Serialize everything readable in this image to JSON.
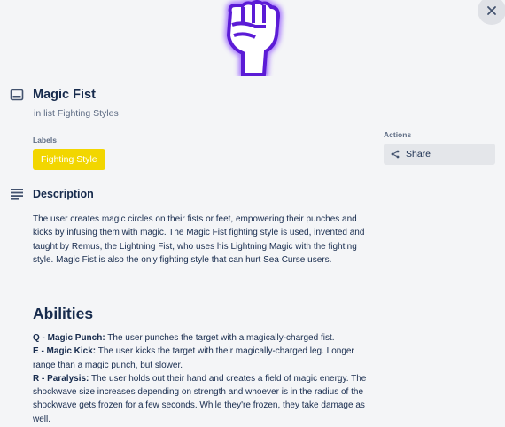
{
  "card": {
    "title": "Magic Fist",
    "list_prefix": "in list",
    "list_name": "Fighting Styles",
    "cover_image": "purple-raised-fist-icon"
  },
  "labels": {
    "heading": "Labels",
    "items": [
      {
        "text": "Fighting Style",
        "color": "#f2d600"
      }
    ]
  },
  "description": {
    "heading": "Description",
    "body": "The user creates magic circles on their fists or feet, empowering their punches and kicks by infusing them with magic. The Magic Fist fighting style is used, invented and taught by Remus, the Lightning Fist, who uses his Lightning Magic with the fighting style. Magic Fist is also the only fighting style that can hurt Sea Curse users."
  },
  "abilities": {
    "heading": "Abilities",
    "items": [
      {
        "key": "Q - Magic Punch:",
        "text": " The user punches the target with a magically-charged fist."
      },
      {
        "key": "E - Magic Kick:",
        "text": " The user kicks the target with their magically-charged leg. Longer range than a magic punch, but slower."
      },
      {
        "key": "R - Paralysis:",
        "text": " The user holds out their hand and creates a field of magic energy. The shockwave size increases depending on strength and whoever is in the radius of the shockwave gets frozen for a few seconds. While they're frozen, they take damage as well."
      }
    ]
  },
  "actions": {
    "heading": "Actions",
    "share_label": "Share"
  },
  "colors": {
    "background": "#f4f5f7",
    "label_yellow": "#f2d600",
    "fist_purple": "#5b1bd6"
  }
}
